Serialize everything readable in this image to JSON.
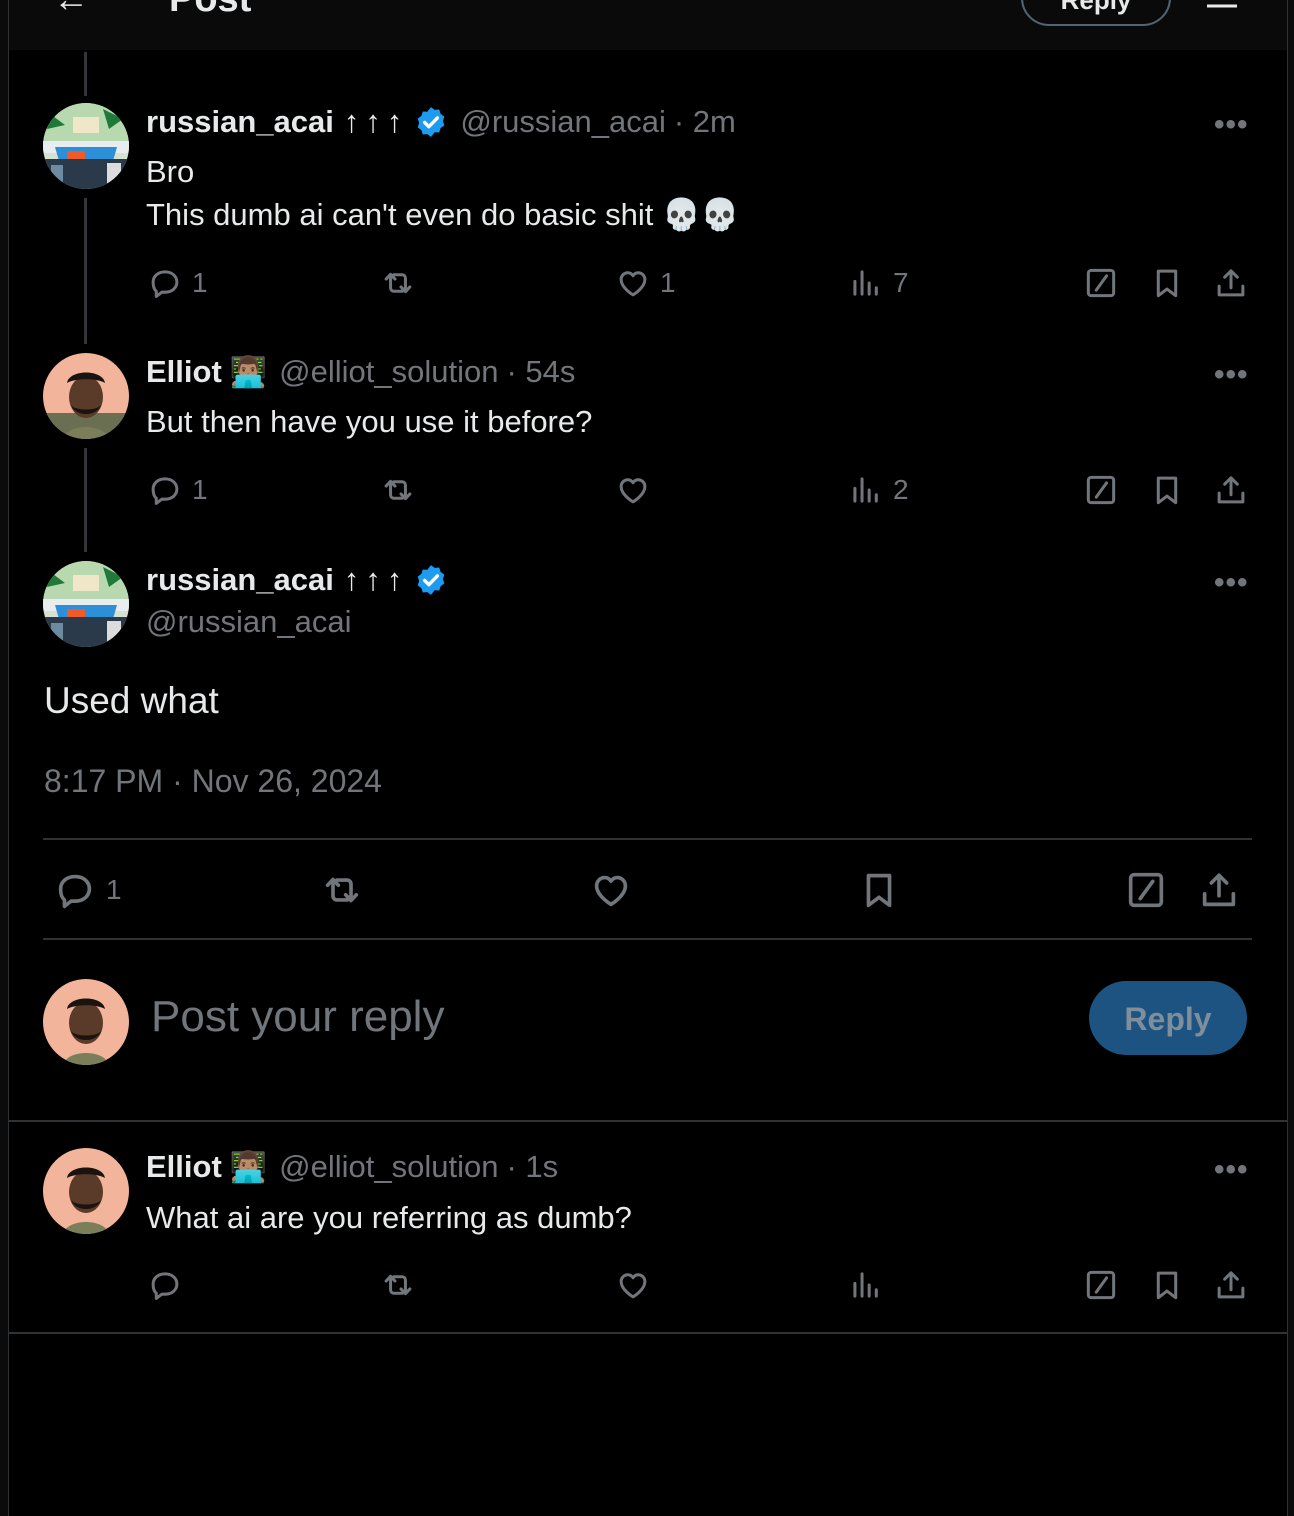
{
  "header": {
    "back_icon": "arrow-left-icon",
    "title": "Post",
    "reply_label": "Reply",
    "filter_icon": "filter-icon"
  },
  "posts": [
    {
      "name": "russian_acai",
      "arrows": "↑↑↑",
      "verified": true,
      "handle": "@russian_acai",
      "time": "· 2m",
      "lines": [
        "Bro",
        "This dumb ai can't even do basic shit 💀💀"
      ],
      "replies": "1",
      "reposts": "",
      "likes": "1",
      "views": "7"
    },
    {
      "name": "Elliot",
      "emoji": "👨🏽‍💻",
      "handle": "@elliot_solution",
      "time": "· 54s",
      "lines": [
        "But then have you use it before?"
      ],
      "replies": "1",
      "reposts": "",
      "likes": "",
      "views": "2"
    }
  ],
  "focus": {
    "name": "russian_acai",
    "arrows": "↑↑↑",
    "verified": true,
    "handle": "@russian_acai",
    "text": "Used what",
    "timestamp": "8:17 PM · Nov 26, 2024",
    "replies": "1"
  },
  "composer": {
    "placeholder": "Post your reply",
    "button": "Reply"
  },
  "reply": {
    "name": "Elliot",
    "emoji": "👨🏽‍💻",
    "handle": "@elliot_solution",
    "time": "· 1s",
    "text": "What ai are you referring as dumb?"
  },
  "more_label": "•••",
  "colors": {
    "background": "#000000",
    "text": "#e7e9ea",
    "muted": "#71767b",
    "verified": "#1d9bf0",
    "reply_button": "#1c5381"
  }
}
